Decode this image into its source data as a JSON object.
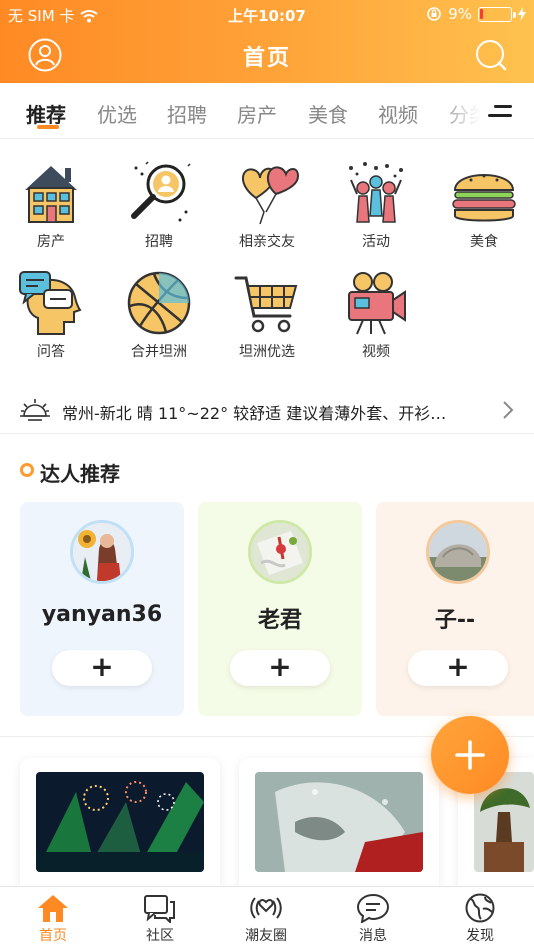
{
  "status_bar": {
    "carrier": "无 SIM 卡",
    "time": "上午10:07",
    "battery_text": "9%",
    "battery_level": 0.09
  },
  "header": {
    "title": "首页"
  },
  "tabs": [
    {
      "label": "推荐",
      "active": true
    },
    {
      "label": "优选",
      "active": false
    },
    {
      "label": "招聘",
      "active": false
    },
    {
      "label": "房产",
      "active": false
    },
    {
      "label": "美食",
      "active": false
    },
    {
      "label": "视频",
      "active": false
    },
    {
      "label": "分类",
      "active": false
    }
  ],
  "categories": [
    {
      "label": "房产",
      "icon": "house-icon"
    },
    {
      "label": "招聘",
      "icon": "magnifier-person-icon"
    },
    {
      "label": "相亲交友",
      "icon": "heart-balloons-icon"
    },
    {
      "label": "活动",
      "icon": "celebration-icon"
    },
    {
      "label": "美食",
      "icon": "burger-icon"
    },
    {
      "label": "问答",
      "icon": "qa-head-icon"
    },
    {
      "label": "合并坦洲",
      "icon": "basketball-icon"
    },
    {
      "label": "坦洲优选",
      "icon": "shopping-cart-icon"
    },
    {
      "label": "视频",
      "icon": "video-camera-icon"
    }
  ],
  "weather": {
    "text": "常州-新北 晴 11°~22° 较舒适 建议着薄外套、开衫…"
  },
  "talent_section": {
    "title": "达人推荐",
    "follow_label": "+",
    "users": [
      {
        "name": "yanyan36",
        "bg": "#eef5fd",
        "ring": "#bfe0f5"
      },
      {
        "name": "老君",
        "bg": "#f4fbe6",
        "ring": "#cfe8a8"
      },
      {
        "name": "子--",
        "bg": "#fdf3ea",
        "ring": "#f2c99d"
      }
    ]
  },
  "fab": {
    "label": "+"
  },
  "bottom_nav": [
    {
      "label": "首页",
      "icon": "home-icon",
      "active": true
    },
    {
      "label": "社区",
      "icon": "chat-bubbles-icon",
      "active": false
    },
    {
      "label": "潮友圈",
      "icon": "broadcast-icon",
      "active": false
    },
    {
      "label": "消息",
      "icon": "message-icon",
      "active": false
    },
    {
      "label": "发现",
      "icon": "globe-icon",
      "active": false
    }
  ],
  "colors": {
    "accent": "#ff8a24",
    "header_gradient_start": "#ff8a24",
    "header_gradient_end": "#ffc24e"
  }
}
